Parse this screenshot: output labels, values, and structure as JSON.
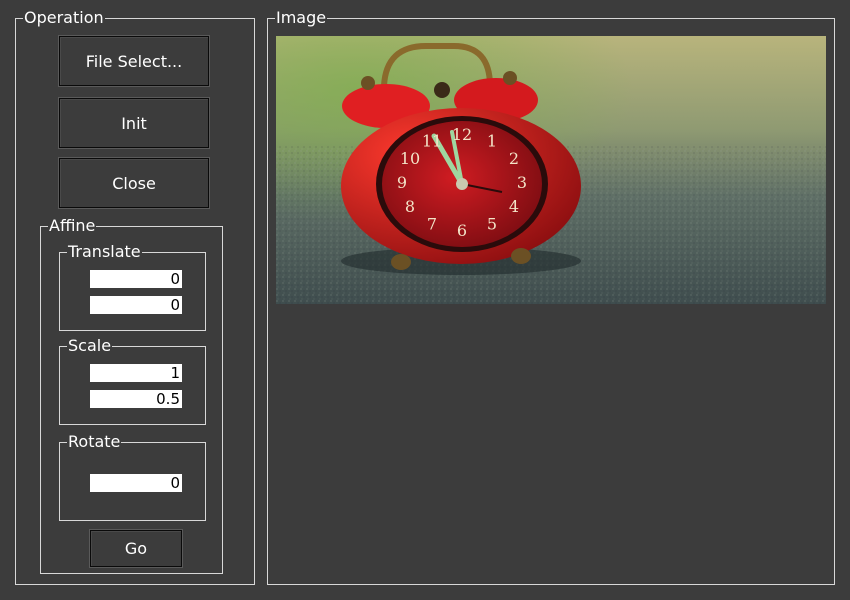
{
  "operation": {
    "title": "Operation",
    "file_select_label": "File Select...",
    "init_label": "Init",
    "close_label": "Close"
  },
  "affine": {
    "title": "Affine",
    "translate": {
      "title": "Translate",
      "x": "0",
      "y": "0"
    },
    "scale": {
      "title": "Scale",
      "x": "1",
      "y": "0.5"
    },
    "rotate": {
      "title": "Rotate",
      "angle": "0"
    },
    "go_label": "Go"
  },
  "image_panel": {
    "title": "Image",
    "photo_subject": "red alarm clock on asphalt",
    "clock_numbers": [
      "12",
      "1",
      "2",
      "3",
      "4",
      "5",
      "6",
      "7",
      "8",
      "9",
      "10",
      "11"
    ]
  },
  "colors": {
    "background": "#3c3c3c",
    "border": "#d8d8d8",
    "field": "#ffffff",
    "clock_red": "#c8141a"
  }
}
